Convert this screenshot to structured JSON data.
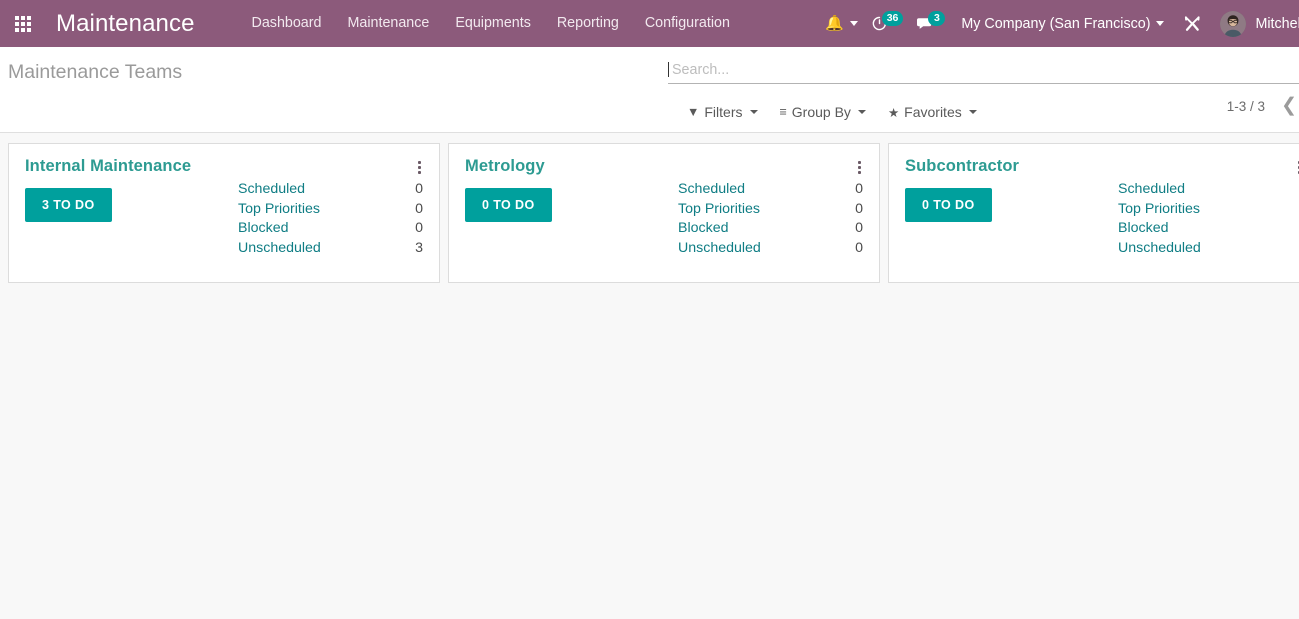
{
  "navbar": {
    "apps_icon": "apps-grid-icon",
    "brand": "Maintenance",
    "menu": [
      {
        "label": "Dashboard"
      },
      {
        "label": "Maintenance"
      },
      {
        "label": "Equipments"
      },
      {
        "label": "Reporting"
      },
      {
        "label": "Configuration"
      }
    ],
    "activities_icon": "bell-icon",
    "timer_icon": "clock-icon",
    "timer_count": "36",
    "messages_icon": "chat-bubble-icon",
    "messages_count": "3",
    "company": "My Company (San Francisco)",
    "tools_icon": "wrench-screwdriver-icon",
    "avatar_icon": "user-avatar",
    "user_name": "Mitchell A"
  },
  "control_panel": {
    "title": "Maintenance Teams",
    "search": {
      "value": "",
      "placeholder": "Search..."
    },
    "buttons": [
      {
        "label": "Filters",
        "icon": "filter-funnel-icon",
        "glyph": "▼"
      },
      {
        "label": "Group By",
        "icon": "hamburger-lines-icon",
        "glyph": "≡"
      },
      {
        "label": "Favorites",
        "icon": "star-icon",
        "glyph": "★"
      }
    ],
    "pager": {
      "range": "1-3 / 3",
      "prev_icon": "chevron-left-icon",
      "prev_glyph": "❮"
    }
  },
  "kanban": {
    "stat_labels": [
      "Scheduled",
      "Top Priorities",
      "Blocked",
      "Unscheduled"
    ],
    "cards": [
      {
        "title": "Internal Maintenance",
        "todo_label": "3 TO DO",
        "stats": [
          {
            "label": "Scheduled",
            "value": "0"
          },
          {
            "label": "Top Priorities",
            "value": "0"
          },
          {
            "label": "Blocked",
            "value": "0"
          },
          {
            "label": "Unscheduled",
            "value": "3"
          }
        ]
      },
      {
        "title": "Metrology",
        "todo_label": "0 TO DO",
        "stats": [
          {
            "label": "Scheduled",
            "value": "0"
          },
          {
            "label": "Top Priorities",
            "value": "0"
          },
          {
            "label": "Blocked",
            "value": "0"
          },
          {
            "label": "Unscheduled",
            "value": "0"
          }
        ]
      },
      {
        "title": "Subcontractor",
        "todo_label": "0 TO DO",
        "stats": [
          {
            "label": "Scheduled",
            "value": ""
          },
          {
            "label": "Top Priorities",
            "value": ""
          },
          {
            "label": "Blocked",
            "value": ""
          },
          {
            "label": "Unscheduled",
            "value": ""
          }
        ]
      }
    ]
  },
  "colors": {
    "header_purple": "#8C5A7B",
    "accent_teal": "#00A09D",
    "link_teal": "#0F7D84",
    "card_title_teal": "#2D9B92",
    "page_bg": "#F8F8F8"
  }
}
